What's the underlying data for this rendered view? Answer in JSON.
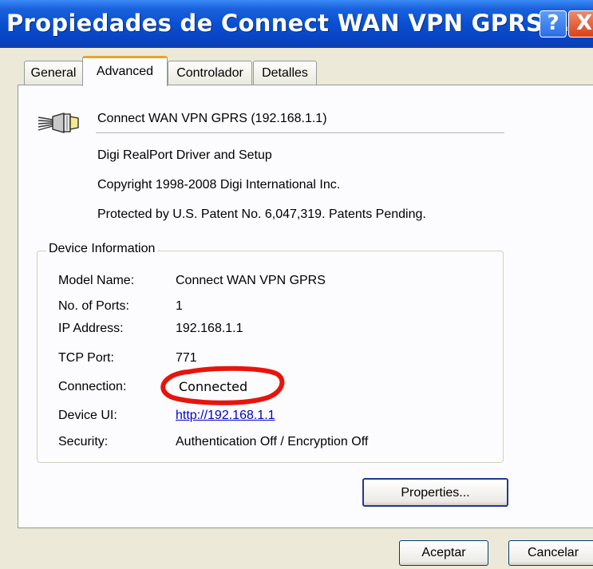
{
  "window": {
    "title": "Propiedades de Connect WAN VPN GPRS...",
    "help_glyph": "?",
    "close_glyph": "X"
  },
  "tabs": [
    {
      "label": "General",
      "active": false
    },
    {
      "label": "Advanced",
      "active": true
    },
    {
      "label": "Controlador",
      "active": false
    },
    {
      "label": "Detalles",
      "active": false
    }
  ],
  "header": {
    "icon": "serial-connector-icon",
    "device_title": "Connect WAN VPN GPRS (192.168.1.1)",
    "lines": [
      "Digi RealPort Driver and Setup",
      "Copyright 1998-2008 Digi International Inc.",
      "Protected by U.S. Patent No. 6,047,319. Patents Pending."
    ]
  },
  "device_info": {
    "group_label": "Device Information",
    "model_name_label": "Model Name:",
    "model_name_value": "Connect WAN VPN GPRS",
    "ports_label": "No. of Ports:",
    "ports_value": "1",
    "ip_label": "IP Address:",
    "ip_value": "192.168.1.1",
    "tcp_label": "TCP Port:",
    "tcp_value": "771",
    "connection_label": "Connection:",
    "connection_value": "Connected",
    "device_ui_label": "Device UI:",
    "device_ui_value": "http://192.168.1.1",
    "security_label": "Security:",
    "security_value": "Authentication Off / Encryption Off",
    "highlight_color": "#e8140c"
  },
  "buttons": {
    "properties": "Properties...",
    "ok": "Aceptar",
    "cancel": "Cancelar"
  }
}
